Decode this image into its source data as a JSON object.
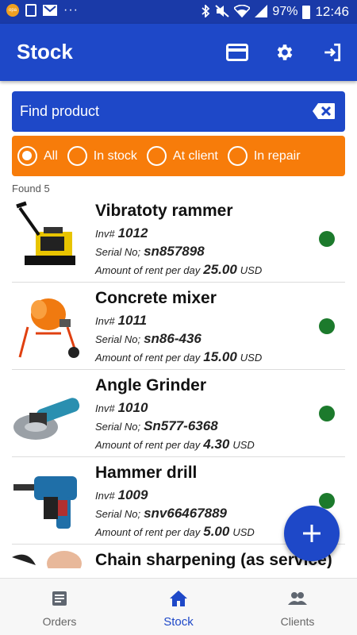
{
  "status_bar": {
    "battery": "97%",
    "time": "12:46"
  },
  "app_bar": {
    "title": "Stock",
    "icons": [
      "card-icon",
      "gear-icon",
      "exit-icon"
    ]
  },
  "search": {
    "placeholder": "Find product"
  },
  "filter": {
    "options": [
      "All",
      "In stock",
      "At client",
      "In repair"
    ],
    "selected": "All"
  },
  "found_label": "Found 5",
  "labels": {
    "inv": "Inv#",
    "serial": "Serial No;",
    "rent": "Amount of rent per day"
  },
  "products": [
    {
      "name": "Vibratoty rammer",
      "inv": "1012",
      "serial": "sn857898",
      "rent": "25.00",
      "currency": "USD",
      "status_color": "#1c7a2c"
    },
    {
      "name": "Concrete mixer",
      "inv": "1011",
      "serial": "sn86-436",
      "rent": "15.00",
      "currency": "USD",
      "status_color": "#1c7a2c"
    },
    {
      "name": "Angle Grinder",
      "inv": "1010",
      "serial": "Sn577-6368",
      "rent": "4.30",
      "currency": "USD",
      "status_color": "#1c7a2c"
    },
    {
      "name": "Hammer drill",
      "inv": "1009",
      "serial": "snv66467889",
      "rent": "5.00",
      "currency": "USD",
      "status_color": "#1c7a2c"
    },
    {
      "name": "Chain sharpening (as service)"
    }
  ],
  "bottom_nav": [
    {
      "label": "Orders",
      "icon": "orders-icon"
    },
    {
      "label": "Stock",
      "icon": "home-icon",
      "active": true
    },
    {
      "label": "Clients",
      "icon": "people-icon"
    }
  ],
  "colors": {
    "primary": "#1e48c8",
    "filter": "#f77c0a",
    "status_ok": "#1c7a2c"
  }
}
